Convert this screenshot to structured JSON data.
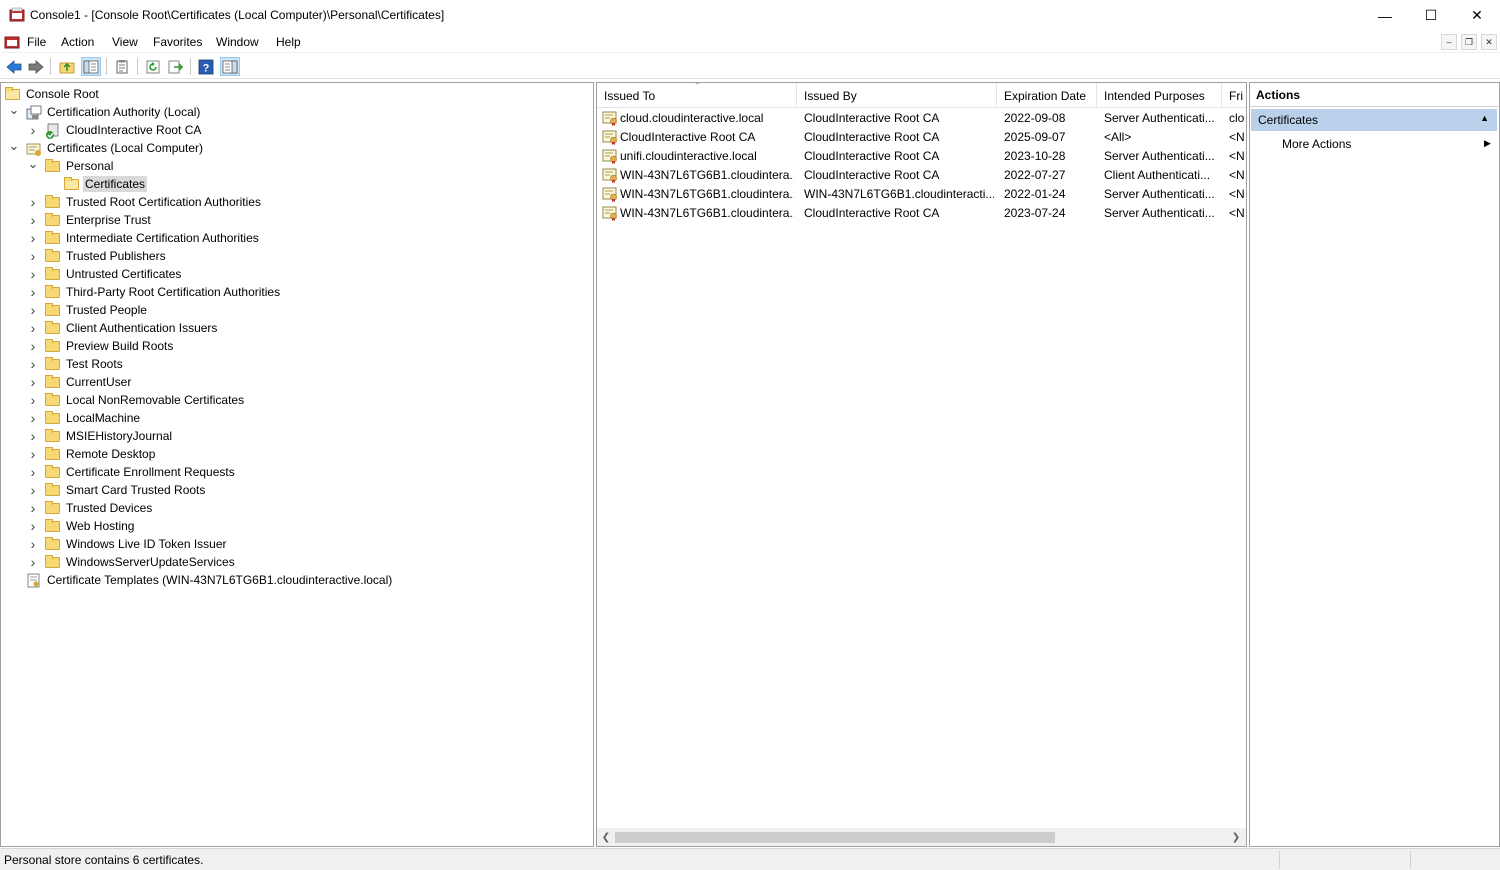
{
  "window": {
    "title": "Console1 - [Console Root\\Certificates (Local Computer)\\Personal\\Certificates]",
    "minimize": "—",
    "maximize": "☐",
    "close": "✕"
  },
  "menu": [
    "File",
    "Action",
    "View",
    "Favorites",
    "Window",
    "Help"
  ],
  "tree": [
    {
      "label": "Console Root",
      "level": 0,
      "icon": "folder-open-icon",
      "expander": ""
    },
    {
      "label": "Certification Authority (Local)",
      "level": 1,
      "icon": "ca-server-icon",
      "expander": "expanded"
    },
    {
      "label": "CloudInteractive Root CA",
      "level": 2,
      "icon": "ca-check-icon",
      "expander": "collapsed"
    },
    {
      "label": "Certificates (Local Computer)",
      "level": 1,
      "icon": "certificates-snapin-icon",
      "expander": "expanded"
    },
    {
      "label": "Personal",
      "level": 2,
      "icon": "folder-icon",
      "expander": "expanded"
    },
    {
      "label": "Certificates",
      "level": 3,
      "icon": "folder-open-icon",
      "expander": "",
      "selected": true
    },
    {
      "label": "Trusted Root Certification Authorities",
      "level": 2,
      "icon": "folder-icon",
      "expander": "collapsed"
    },
    {
      "label": "Enterprise Trust",
      "level": 2,
      "icon": "folder-icon",
      "expander": "collapsed"
    },
    {
      "label": "Intermediate Certification Authorities",
      "level": 2,
      "icon": "folder-icon",
      "expander": "collapsed"
    },
    {
      "label": "Trusted Publishers",
      "level": 2,
      "icon": "folder-icon",
      "expander": "collapsed"
    },
    {
      "label": "Untrusted Certificates",
      "level": 2,
      "icon": "folder-icon",
      "expander": "collapsed"
    },
    {
      "label": "Third-Party Root Certification Authorities",
      "level": 2,
      "icon": "folder-icon",
      "expander": "collapsed"
    },
    {
      "label": "Trusted People",
      "level": 2,
      "icon": "folder-icon",
      "expander": "collapsed"
    },
    {
      "label": "Client Authentication Issuers",
      "level": 2,
      "icon": "folder-icon",
      "expander": "collapsed"
    },
    {
      "label": "Preview Build Roots",
      "level": 2,
      "icon": "folder-icon",
      "expander": "collapsed"
    },
    {
      "label": "Test Roots",
      "level": 2,
      "icon": "folder-icon",
      "expander": "collapsed"
    },
    {
      "label": "CurrentUser",
      "level": 2,
      "icon": "folder-icon",
      "expander": "collapsed"
    },
    {
      "label": "Local NonRemovable Certificates",
      "level": 2,
      "icon": "folder-icon",
      "expander": "collapsed"
    },
    {
      "label": "LocalMachine",
      "level": 2,
      "icon": "folder-icon",
      "expander": "collapsed"
    },
    {
      "label": "MSIEHistoryJournal",
      "level": 2,
      "icon": "folder-icon",
      "expander": "collapsed"
    },
    {
      "label": "Remote Desktop",
      "level": 2,
      "icon": "folder-icon",
      "expander": "collapsed"
    },
    {
      "label": "Certificate Enrollment Requests",
      "level": 2,
      "icon": "folder-icon",
      "expander": "collapsed"
    },
    {
      "label": "Smart Card Trusted Roots",
      "level": 2,
      "icon": "folder-icon",
      "expander": "collapsed"
    },
    {
      "label": "Trusted Devices",
      "level": 2,
      "icon": "folder-icon",
      "expander": "collapsed"
    },
    {
      "label": "Web Hosting",
      "level": 2,
      "icon": "folder-icon",
      "expander": "collapsed"
    },
    {
      "label": "Windows Live ID Token Issuer",
      "level": 2,
      "icon": "folder-icon",
      "expander": "collapsed"
    },
    {
      "label": "WindowsServerUpdateServices",
      "level": 2,
      "icon": "folder-icon",
      "expander": "collapsed"
    },
    {
      "label": "Certificate Templates (WIN-43N7L6TG6B1.cloudinteractive.local)",
      "level": 1,
      "icon": "certificate-templates-icon",
      "expander": ""
    }
  ],
  "list": {
    "columns": [
      "Issued To",
      "Issued By",
      "Expiration Date",
      "Intended Purposes",
      "Fri"
    ],
    "rows": [
      [
        "cloud.cloudinteractive.local",
        "CloudInteractive Root CA",
        "2022-09-08",
        "Server Authenticati...",
        "clo"
      ],
      [
        "CloudInteractive Root CA",
        "CloudInteractive Root CA",
        "2025-09-07",
        "<All>",
        "<N"
      ],
      [
        "unifi.cloudinteractive.local",
        "CloudInteractive Root CA",
        "2023-10-28",
        "Server Authenticati...",
        "<N"
      ],
      [
        "WIN-43N7L6TG6B1.cloudintera...",
        "CloudInteractive Root CA",
        "2022-07-27",
        "Client Authenticati...",
        "<N"
      ],
      [
        "WIN-43N7L6TG6B1.cloudintera...",
        "WIN-43N7L6TG6B1.cloudinteracti...",
        "2022-01-24",
        "Server Authenticati...",
        "<N"
      ],
      [
        "WIN-43N7L6TG6B1.cloudintera...",
        "CloudInteractive Root CA",
        "2023-07-24",
        "Server Authenticati...",
        "<N"
      ]
    ]
  },
  "actions": {
    "title": "Actions",
    "section": "Certificates",
    "items": [
      "More Actions"
    ]
  },
  "status": {
    "text": "Personal store contains 6 certificates."
  },
  "colors": {
    "selection": "#d9d9d9",
    "actions_section_bg": "#b9d1ea",
    "folder": "#f8d775"
  }
}
